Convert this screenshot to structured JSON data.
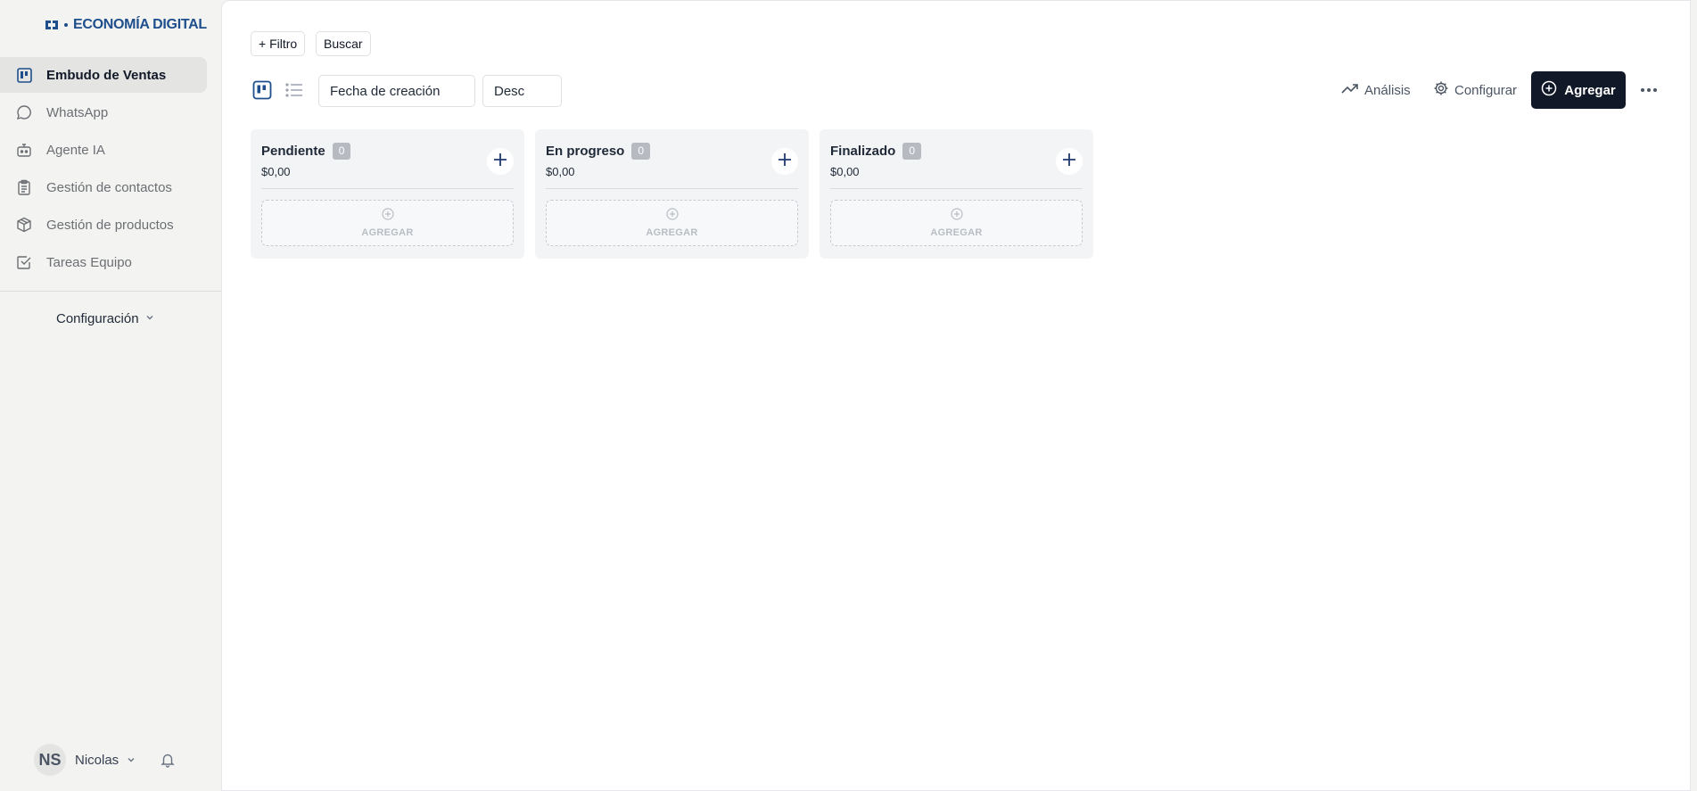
{
  "brand": {
    "logo_text": "ECONOMÍA DIGITAL",
    "color": "#1e4e8c"
  },
  "sidebar": {
    "items": [
      {
        "label": "Embudo de Ventas",
        "icon": "kanban-icon",
        "active": true
      },
      {
        "label": "WhatsApp",
        "icon": "chat-bubble-icon"
      },
      {
        "label": "Agente IA",
        "icon": "bot-icon"
      },
      {
        "label": "Gestión de contactos",
        "icon": "clipboard-icon"
      },
      {
        "label": "Gestión de productos",
        "icon": "package-icon"
      },
      {
        "label": "Tareas Equipo",
        "icon": "checkbox-icon"
      }
    ],
    "config_label": "Configuración"
  },
  "user": {
    "initials": "NS",
    "name": "Nicolas"
  },
  "toolbar": {
    "filter_label": "+ Filtro",
    "search_label": "Buscar",
    "sort_field": "Fecha de creación",
    "sort_order": "Desc",
    "analytics_label": "Análisis",
    "configure_label": "Configurar",
    "add_label": "Agregar"
  },
  "board": {
    "add_card_label": "AGREGAR",
    "columns": [
      {
        "title": "Pendiente",
        "count": "0",
        "total": "$0,00"
      },
      {
        "title": "En progreso",
        "count": "0",
        "total": "$0,00"
      },
      {
        "title": "Finalizado",
        "count": "0",
        "total": "$0,00"
      }
    ]
  },
  "colors": {
    "primary_button": "#111827",
    "accent": "#1e4e8c",
    "badge": "#b7bbc1"
  }
}
